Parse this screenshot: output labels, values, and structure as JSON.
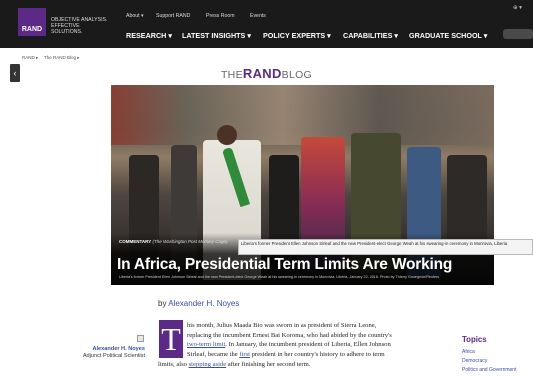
{
  "header": {
    "logo_text": "RAND",
    "tagline": "OBJECTIVE ANALYSIS. EFFECTIVE SOLUTIONS.",
    "util_links": [
      "About ▾",
      "Support RAND",
      "Press Room",
      "Events"
    ],
    "nav": [
      "RESEARCH ▾",
      "LATEST INSIGHTS ▾",
      "POLICY EXPERTS ▾",
      "CAPABILITIES ▾",
      "GRADUATE SCHOOL ▾"
    ],
    "globe": "⊕ ▾"
  },
  "breadcrumb": [
    "RAND ▸",
    "The RAND Blog ▸"
  ],
  "blog": {
    "the": "THE",
    "rand": "RAND",
    "blog": "BLOG"
  },
  "hero": {
    "label_type": "COMMENTARY",
    "label_source": "(The Washington Post Monkey Cage)",
    "title": "In Africa, Presidential Term Limits Are Working",
    "caption": "Liberia's former President Ellen Johnson Sirleaf and the new President-elect George Weah at his swearing-in ceremony in Monrovia, Liberia, January 22, 2018. Photo by Thierry Gouegnon/Reuters",
    "tooltip": "Liberia's former President Ellen Johnson Sirleaf and the new President-elect George Weah at his swearing-in ceremony in Monrovia, Liberia"
  },
  "article": {
    "by": "by",
    "author": "Alexander H. Noyes",
    "author_card_name": "Alexander H. Noyes",
    "author_card_role": "Adjunct Political Scientist",
    "dropcap": "T",
    "line1": "his month, Julius Maada Bio was sworn in as president of Sierra Leone,",
    "line2": "replacing the incumbent Ernest Bai Koroma, who had abided by the country's",
    "link_two_term": "two-term limit",
    "line3b": ". In January, the incumbent president of Liberia, Ellen Johnson",
    "line4a": "Sirleaf, became the ",
    "link_first": "first",
    "line4b": " president in her country's history to adhere to term",
    "line5a": "limits, also ",
    "link_stepping": "stepping aside",
    "line5b": " after finishing her second term."
  },
  "topics": {
    "heading": "Topics",
    "items": [
      "Africa",
      "Democracy",
      "Politics and Government"
    ]
  },
  "colors": {
    "brand_purple": "#5b2a86",
    "link_blue": "#3b4fa0",
    "header_bg": "#1a1a1a"
  }
}
